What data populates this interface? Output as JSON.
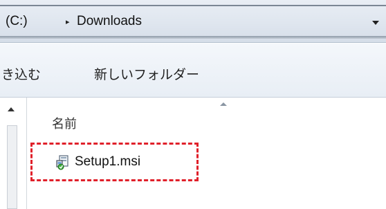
{
  "address": {
    "drive": "(C:)",
    "separator": "▸",
    "folder": "Downloads"
  },
  "toolbar": {
    "include_label": "き込む",
    "new_folder_label": "新しいフォルダー"
  },
  "file_list": {
    "column_name": "名前",
    "files": [
      {
        "name": "Setup1.msi",
        "icon": "msi-installer-icon"
      }
    ]
  },
  "colors": {
    "highlight_border": "#e0202a"
  }
}
